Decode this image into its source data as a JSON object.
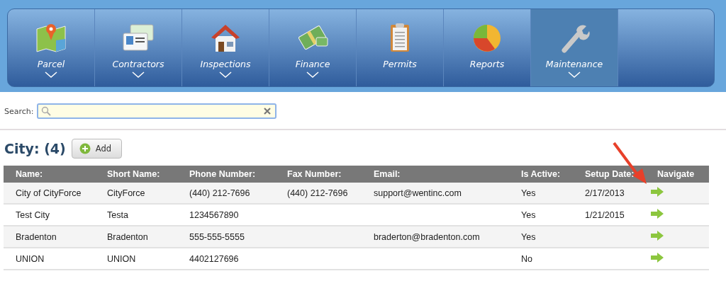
{
  "nav": [
    {
      "label": "Parcel",
      "kind": "map",
      "has_menu": true,
      "selected": false
    },
    {
      "label": "Contractors",
      "kind": "cards",
      "has_menu": true,
      "selected": false
    },
    {
      "label": "Inspections",
      "kind": "house",
      "has_menu": true,
      "selected": false
    },
    {
      "label": "Finance",
      "kind": "money",
      "has_menu": true,
      "selected": false
    },
    {
      "label": "Permits",
      "kind": "clipboard",
      "has_menu": false,
      "selected": false
    },
    {
      "label": "Reports",
      "kind": "pie",
      "has_menu": false,
      "selected": false
    },
    {
      "label": "Maintenance",
      "kind": "wrench",
      "has_menu": true,
      "selected": true
    }
  ],
  "search": {
    "label": "Search:"
  },
  "section": {
    "title": "City: (4)",
    "add_button": "Add"
  },
  "table": {
    "columns": [
      "Name:",
      "Short Name:",
      "Phone Number:",
      "Fax Number:",
      "Email:",
      "Is Active:",
      "Setup Date:",
      "Navigate"
    ],
    "rows": [
      [
        "City of CityForce",
        "CityForce",
        "(440) 212-7696",
        "(440) 212-7696",
        "support@wentinc.com",
        "Yes",
        "2/17/2013"
      ],
      [
        "Test City",
        "Testa",
        "1234567890",
        "",
        "",
        "Yes",
        "1/21/2015"
      ],
      [
        "Bradenton",
        "Bradenton",
        "555-555-5555",
        "",
        "braderton@bradenton.com",
        "Yes",
        ""
      ],
      [
        "UNION",
        "UNION",
        "4402127696",
        "",
        "",
        "No",
        ""
      ]
    ]
  },
  "annotation": {
    "kind": "arrow"
  }
}
